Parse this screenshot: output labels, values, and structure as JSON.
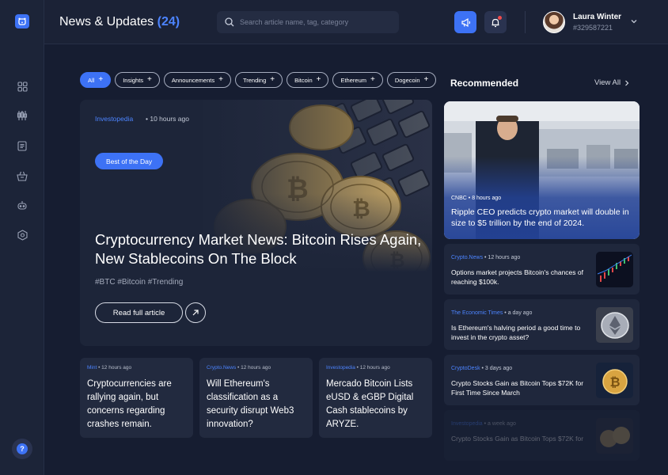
{
  "header": {
    "title": "News & Updates",
    "count": "(24)",
    "search_placeholder": "Search article name, tag, category",
    "user_name": "Laura Winter",
    "user_id": "#329587221"
  },
  "sidebar": {
    "items": [
      {
        "icon": "grid-icon"
      },
      {
        "icon": "candlestick-chart-icon"
      },
      {
        "icon": "document-icon"
      },
      {
        "icon": "basket-icon"
      },
      {
        "icon": "robot-icon"
      },
      {
        "icon": "settings-hexagon-icon"
      }
    ],
    "help_label": "?"
  },
  "filters": [
    {
      "label": "All",
      "active": true
    },
    {
      "label": "Insights"
    },
    {
      "label": "Announcements"
    },
    {
      "label": "Trending"
    },
    {
      "label": "Bitcoin"
    },
    {
      "label": "Ethereum"
    },
    {
      "label": "Dogecoin"
    }
  ],
  "hero": {
    "source": "Investopedia",
    "time": "10 hours ago",
    "badge": "Best of the Day",
    "title": "Cryptocurrency Market News: Bitcoin Rises Again, New Stablecoins On The Block",
    "tags": "#BTC  #Bitcoin  #Trending",
    "button": "Read full article"
  },
  "mini_cards": [
    {
      "source": "Mint",
      "time": "12 hours ago",
      "title": "Cryptocurrencies are rallying again, but concerns regarding crashes remain."
    },
    {
      "source": "Crypto.News",
      "time": "12 hours ago",
      "title": "Will Ethereum's classification as a security disrupt Web3 innovation?"
    },
    {
      "source": "Investopedia",
      "time": "12 hours ago",
      "title": "Mercado Bitcoin Lists eUSD & eGBP Digital Cash stablecoins by ARYZE."
    }
  ],
  "recommended": {
    "title": "Recommended",
    "view_all": "View All",
    "featured": {
      "source": "CNBC",
      "time": "8 hours ago",
      "title": "Ripple CEO predicts crypto market will double in size to $5 trillion by the end of 2024."
    },
    "items": [
      {
        "source": "Crypto.News",
        "time": "12 hours ago",
        "title": "Options market projects Bitcoin's chances of reaching $100k."
      },
      {
        "source": "The Economic Times",
        "time": "a day ago",
        "title": "Is Ethereum's halving period a good time to invest in the crypto asset?"
      },
      {
        "source": "CryptoDesk",
        "time": "3 days ago",
        "title": "Crypto Stocks Gain as Bitcoin Tops $72K for First Time Since March"
      },
      {
        "source": "Investopedia",
        "time": "a week ago",
        "title": "Crypto Stocks Gain as Bitcoin Tops $72K for"
      }
    ]
  },
  "colors": {
    "accent": "#3d72f5",
    "background": "#161d31",
    "card": "#222a3f",
    "link": "#4c84ff"
  }
}
